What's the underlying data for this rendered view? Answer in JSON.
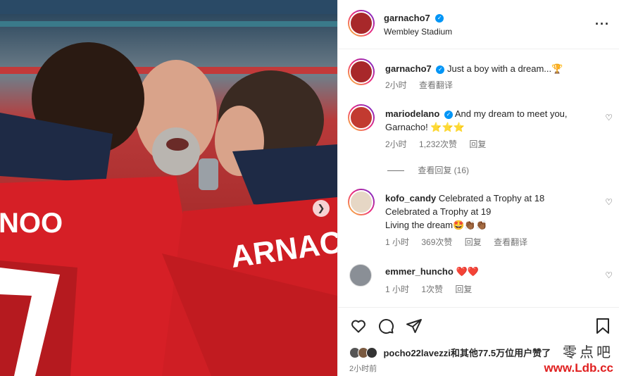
{
  "post_header": {
    "username": "garnacho7",
    "location": "Wembley Stadium",
    "more_icon": "more-horizontal-icon"
  },
  "caption": {
    "username": "garnacho7",
    "text": "Just a boy with a dream...🏆",
    "time": "2小时",
    "translate": "查看翻译"
  },
  "comments": [
    {
      "username": "mariodelano",
      "verified": true,
      "text": "And my dream to meet you, Garnacho! ⭐⭐⭐",
      "time": "2小时",
      "likes": "1,232次赞",
      "reply": "回复"
    },
    {
      "username": "kofo_candy",
      "verified": false,
      "text_lines": [
        "Celebrated a Trophy at 18",
        "Celebrated a Trophy at 19",
        "Living the dream🤩👏🏾👏🏾"
      ],
      "time": "1 小时",
      "likes": "369次赞",
      "reply": "回复",
      "translate": "查看翻译"
    },
    {
      "username": "emmer_huncho",
      "verified": false,
      "text": "❤️❤️",
      "time": "1 小时",
      "likes": "1次赞",
      "reply": "回复"
    }
  ],
  "view_replies": "查看回复 (16)",
  "likes_line": "pocho22lavezzi和其他77.5万位用户赞了",
  "timestamp": "2小时前",
  "photo_text": {
    "jersey_left": "NOO",
    "jersey_right": "ARNAC",
    "number": "7"
  },
  "watermark": {
    "line1": "零点吧",
    "line2": "www.Ldb.cc"
  },
  "colors": {
    "accent_blue": "#0095f6",
    "red": "#d61f26"
  }
}
